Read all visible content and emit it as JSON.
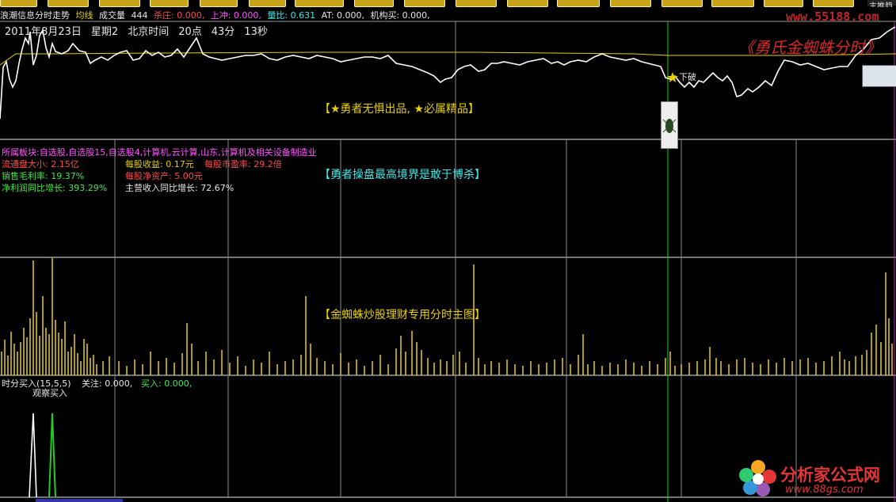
{
  "toolbar": {
    "right_label": "主推趋"
  },
  "info_bar": {
    "title": "浪潮信息分时走势",
    "avg_label": "均线",
    "vol_label": "成交量",
    "vol_value": "444",
    "kill_label": "杀庄: 0.000,",
    "up_label": "上冲: 0.000,",
    "ratio_label": "量比: 0.631",
    "at_label": "AT: 0.000,",
    "inst_label": "机构买: 0.000,"
  },
  "datetime": {
    "date": "2011年8月23日",
    "weekday": "星期2",
    "time_label": "北京时间",
    "hour": "20点",
    "minute": "43分",
    "second": "13秒"
  },
  "watermark_top": "www.55188.com",
  "brand_title": "《勇氏金蜘蛛分时》",
  "signal_label": "下破",
  "banners": {
    "top": "【★勇者无惧出品, ★必属精品】",
    "middle": "【勇者操盘最高境界是敢于博杀】",
    "volume": "【金蜘蛛炒股理财专用分时主图】"
  },
  "stock_info": {
    "sectors": "所属板块:自选股,自选股15,自选股4,计算机,云计算,山东,计算机及相关设备制造业",
    "float_cap": "流通盘大小: 2.15亿",
    "eps": "每股收益: 0.17元",
    "pe": "每股市盈率: 29.2倍",
    "gross_margin": "销售毛利率: 19.37%",
    "bvps": "每股净资产: 5.00元",
    "net_profit_growth": "净利润同比增长: 393.29%",
    "revenue_growth": "主营收入同比增长: 72.67%"
  },
  "sub_indicator": {
    "title": "时分买入(15,5,5)",
    "focus": "关注: 0.000,",
    "buy": "买入: 0.000,",
    "observe": "观察买入"
  },
  "bottom_logo": {
    "cn": "分析家公式网",
    "url": "www.88gs.com"
  },
  "colors": {
    "price_line": "#ffffff",
    "avg_line": "#e8d000",
    "grid": "#9a9a9a",
    "cursor": "#22cc22",
    "volume_bar": "#e8d000",
    "buy_spike": "#22cc22"
  }
}
